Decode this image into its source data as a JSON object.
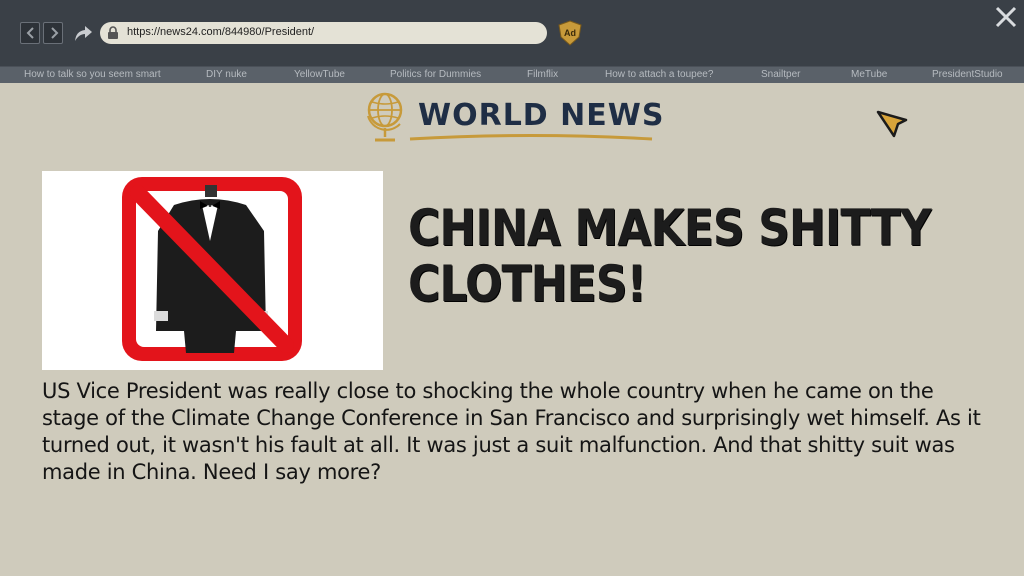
{
  "browser": {
    "url": "https://news24.com/844980/President/",
    "ad_badge": "Ad",
    "close_glyph": "✕"
  },
  "bookmarks": [
    "How to talk so you seem smart",
    "DIY nuke",
    "YellowTube",
    "Politics for Dummies",
    "Filmflix",
    "How to attach a toupee?",
    "Snailtper",
    "MeTube",
    "PresidentStudio"
  ],
  "page": {
    "section_title": "WORLD NEWS",
    "headline": "CHINA MAKES SHITTY CLOTHES!",
    "body": "US Vice President was really close to shocking the whole country when he came on the stage of the Climate Change Conference in San Francisco and surprisingly wet himself. As it turned out, it wasn't his fault at all. It was just a suit malfunction. And that shitty suit was made in China. Need I say more?"
  },
  "icons": {
    "back": "chevron-left-icon",
    "forward": "chevron-right-icon",
    "share": "share-arrow-icon",
    "lock": "lock-icon",
    "ad": "ad-badge-icon",
    "close": "close-icon",
    "globe": "globe-icon",
    "cursor": "cursor-icon",
    "no_suit": "prohibited-suit-image"
  },
  "colors": {
    "page_bg": "#cfcbbc",
    "topbar_bg": "#3a4047",
    "title_navy": "#1f2e45",
    "accent_gold": "#c79a3a",
    "prohibit_red": "#e3141b"
  }
}
